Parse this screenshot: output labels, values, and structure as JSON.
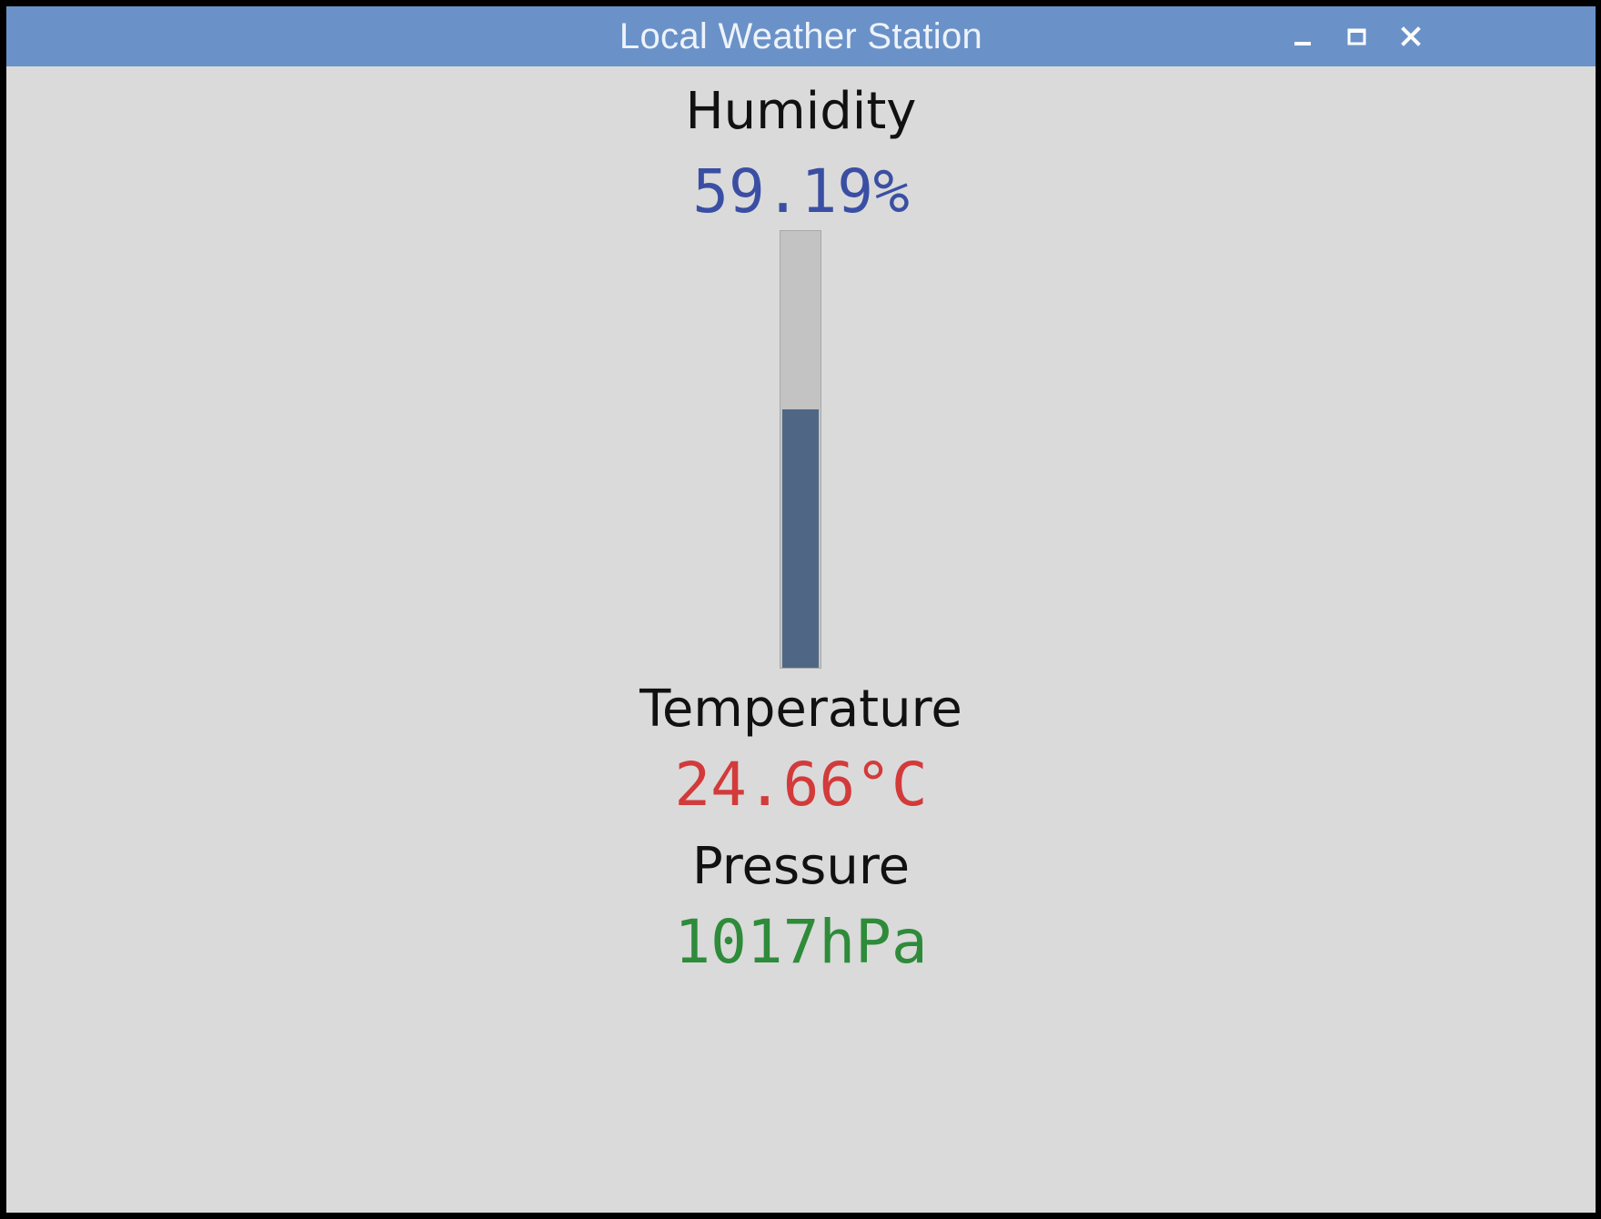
{
  "window": {
    "title": "Local Weather Station"
  },
  "humidity": {
    "label": "Humidity",
    "value": "59.19%",
    "fill_fraction": 0.5919,
    "color": "#3a4fa3"
  },
  "temperature": {
    "label": "Temperature",
    "value": "24.66°C",
    "color": "#d33a3a"
  },
  "pressure": {
    "label": "Pressure",
    "value": "1017hPa",
    "color": "#2e8b3a"
  },
  "colors": {
    "titlebar": "#6a92c8",
    "background": "#dadada",
    "gauge_fill": "#4f6784",
    "gauge_track": "#c3c3c3"
  },
  "icons": {
    "minimize": "minimize-icon",
    "maximize": "maximize-icon",
    "close": "close-icon"
  }
}
